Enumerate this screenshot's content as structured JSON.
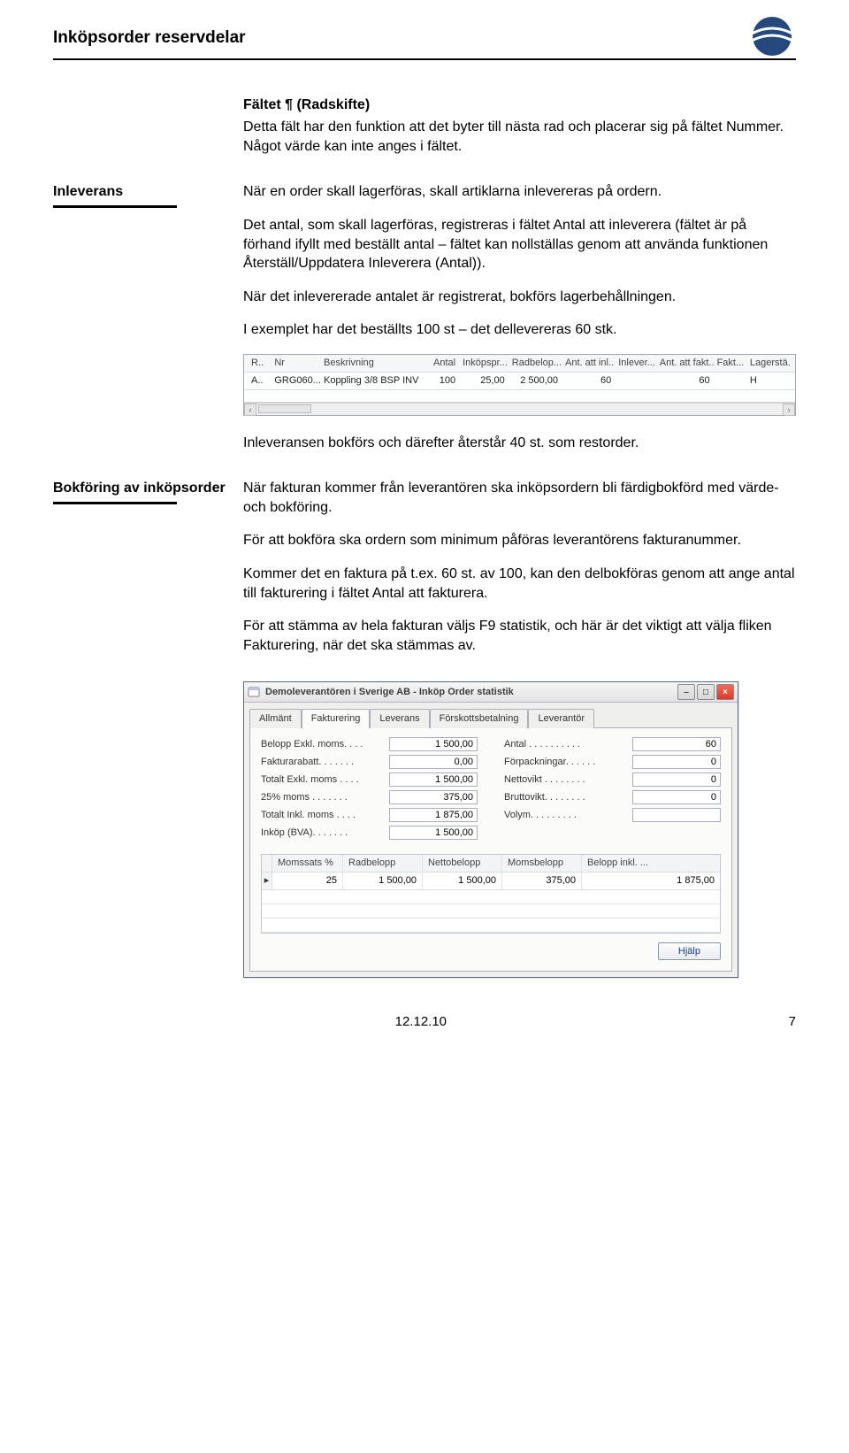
{
  "page": {
    "main_title": "Inköpsorder reservdelar",
    "footer_date": "12.12.10",
    "footer_page": "7"
  },
  "sections": {
    "radskifte": {
      "title": "Fältet ¶ (Radskifte)",
      "body": "Detta fält har den funktion att det byter till nästa rad och placerar sig på fältet Nummer. Något värde kan inte anges i fältet."
    },
    "inleverans": {
      "label": "Inleverans",
      "p1": "När en order skall lagerföras, skall artiklarna inlevereras på ordern.",
      "p2": "Det antal, som skall lagerföras, registreras i fältet Antal att inleverera (fältet är på förhand ifyllt med beställt antal – fältet kan nollställas genom att använda funktionen Återställ/Uppdatera Inleverera (Antal)).",
      "p3": "När det inlevererade antalet är registrerat, bokförs lagerbehållningen.",
      "p4": "I exemplet har det beställts 100 st – det dellevereras 60 stk.",
      "p5": "Inleveransen bokförs och därefter återstår 40 st. som restorder."
    },
    "bokforing": {
      "label": "Bokföring av inköpsorder",
      "p1": "När fakturan kommer från leverantören ska inköpsordern bli färdigbokförd med värde- och bokföring.",
      "p2": "För att bokföra ska ordern som minimum påföras leverantörens fakturanummer.",
      "p3": "Kommer det en faktura på t.ex. 60 st. av 100, kan den delbokföras genom att ange antal till fakturering i fältet Antal att fakturera.",
      "p4": "För att stämma av hela fakturan väljs F9 statistik, och här är det viktigt att välja fliken Fakturering, när det ska stämmas av."
    }
  },
  "embedded_table": {
    "headers": [
      "R..",
      "Nr",
      "Beskrivning",
      "Antal",
      "Inköpspr...",
      "Radbelop...",
      "Ant. att inl...",
      "Inlever...",
      "Ant. att fakt...",
      "Fakt...",
      "Lagerstä."
    ],
    "row": [
      "A..",
      "GRG060...",
      "Koppling 3/8 BSP INV",
      "100",
      "25,00",
      "2 500,00",
      "60",
      "",
      "60",
      "",
      "H"
    ]
  },
  "dialog": {
    "title": "Demoleverantören i Sverige AB - Inköp Order statistik",
    "tabs": [
      "Allmänt",
      "Fakturering",
      "Leverans",
      "Förskottsbetalning",
      "Leverantör"
    ],
    "active_tab": "Fakturering",
    "left_fields": [
      {
        "label": "Belopp Exkl. moms.  .  .  .",
        "value": "1 500,00"
      },
      {
        "label": "Fakturarabatt.  .  .  .  .  .  .",
        "value": "0,00"
      },
      {
        "label": "Totalt Exkl. moms  .  .  .  .",
        "value": "1 500,00"
      },
      {
        "label": "25% moms .  .  .  .  .  .  .",
        "value": "375,00"
      },
      {
        "label": "Totalt Inkl. moms .  .  .  .",
        "value": "1 875,00"
      },
      {
        "label": "Inköp (BVA).  .  .  .  .  .  .",
        "value": "1 500,00"
      }
    ],
    "right_fields": [
      {
        "label": "Antal .  .  .  .  .  .  .  .  .  .",
        "value": "60"
      },
      {
        "label": "Förpackningar.  .  .  .  .  .",
        "value": "0"
      },
      {
        "label": "Nettovikt .  .  .  .  .  .  .  .",
        "value": "0"
      },
      {
        "label": "Bruttovikt.  .  .  .  .  .  .  .",
        "value": "0"
      },
      {
        "label": "Volym.  .  .  .  .  .  .  .  .",
        "value": ""
      }
    ],
    "subtable": {
      "headers": [
        "Momssats %",
        "Radbelopp",
        "Nettobelopp",
        "Momsbelopp",
        "Belopp inkl. ..."
      ],
      "row": [
        "25",
        "1 500,00",
        "1 500,00",
        "375,00",
        "1 875,00"
      ]
    },
    "help_label": "Hjälp"
  }
}
